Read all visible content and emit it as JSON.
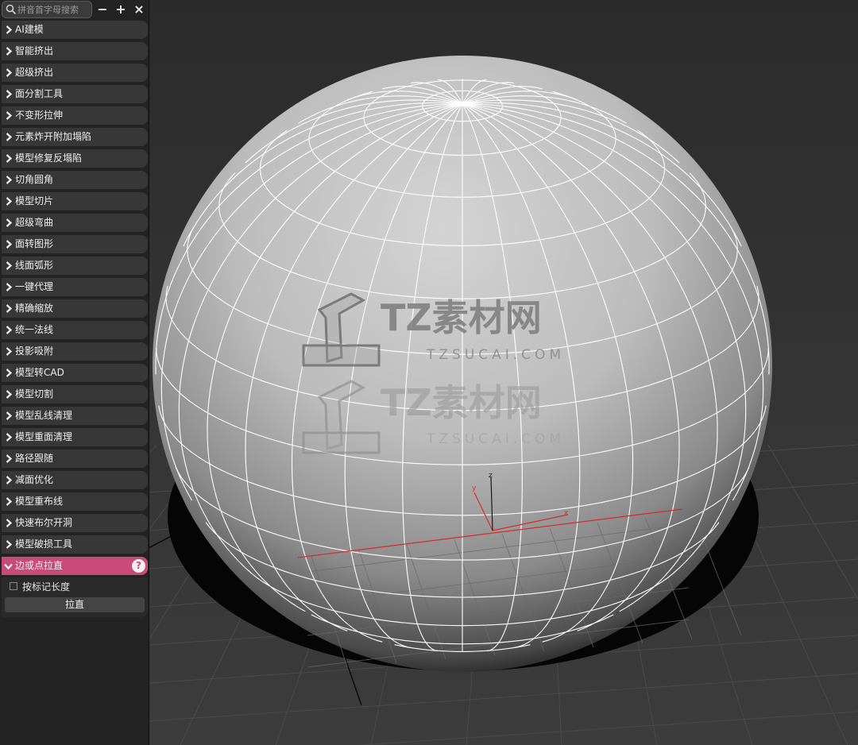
{
  "search": {
    "placeholder": "拼音首字母搜索"
  },
  "toolbar": {
    "collapse": "−",
    "expand": "+",
    "close": "×"
  },
  "menu": [
    {
      "label": "AI建模"
    },
    {
      "label": "智能挤出"
    },
    {
      "label": "超级挤出"
    },
    {
      "label": "面分割工具"
    },
    {
      "label": "不变形拉伸"
    },
    {
      "label": "元素炸开附加塌陷"
    },
    {
      "label": "模型修复反塌陷"
    },
    {
      "label": "切角圆角"
    },
    {
      "label": "模型切片"
    },
    {
      "label": "超级弯曲"
    },
    {
      "label": "面转图形"
    },
    {
      "label": "线面弧形"
    },
    {
      "label": "一键代理"
    },
    {
      "label": "精确缩放"
    },
    {
      "label": "统一法线"
    },
    {
      "label": "投影吸附"
    },
    {
      "label": "模型转CAD"
    },
    {
      "label": "模型切割"
    },
    {
      "label": "模型乱线清理"
    },
    {
      "label": "模型重面清理"
    },
    {
      "label": "路径跟随"
    },
    {
      "label": "减面优化"
    },
    {
      "label": "模型重布线"
    },
    {
      "label": "快速布尔开洞"
    },
    {
      "label": "模型破损工具"
    }
  ],
  "active_section": {
    "label": "边或点拉直",
    "help": "?"
  },
  "options": {
    "checkbox_label": "按标记长度",
    "checked": false
  },
  "actions": {
    "straighten_label": "拉直"
  },
  "watermark": {
    "brand": "TZ素材网",
    "url": "TZSUCAI.COM"
  },
  "gizmo": {
    "x": "x",
    "y": "y",
    "z": "z"
  },
  "colors": {
    "active_row": "#c94a77",
    "gizmo_red": "#d62b2b",
    "panel_bg": "#232323"
  }
}
